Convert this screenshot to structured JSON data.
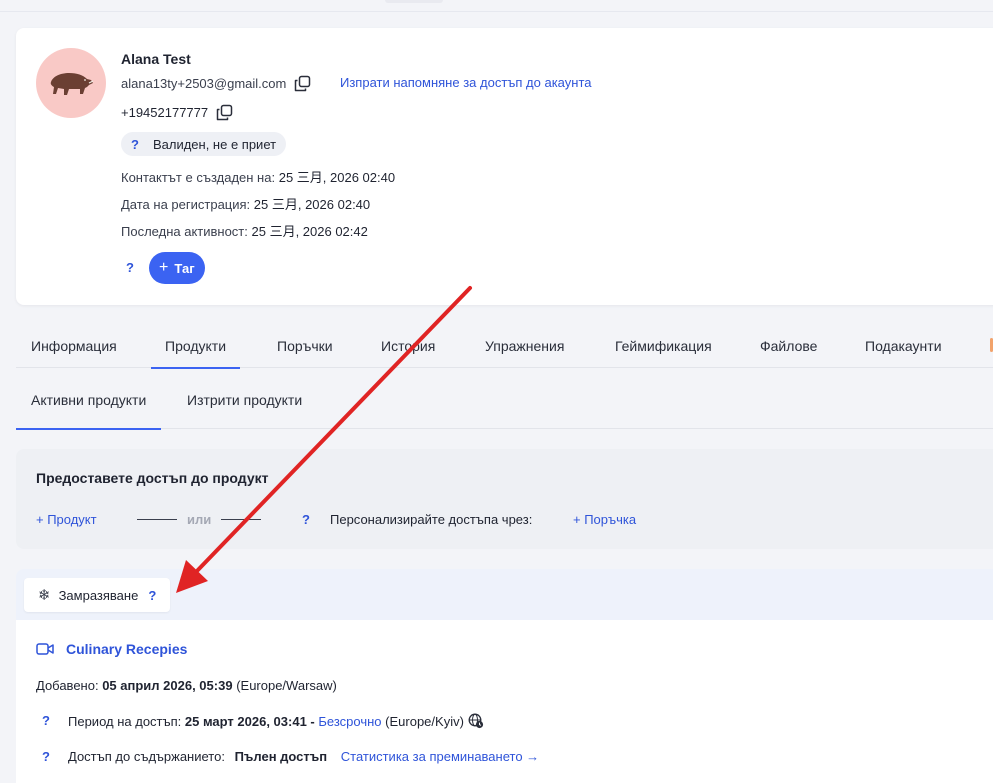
{
  "contact": {
    "name": "Alana Test",
    "email": "alana13ty+2503@gmail.com",
    "reminder_link": "Изпрати напомняне за достъп до акаунта",
    "phone": "+19452177777",
    "status_q": "?",
    "status": "Валиден, не е приет",
    "created_label": "Контактът е създаден на:",
    "created_value": "25 三月, 2026 02:40",
    "registered_label": "Дата на регистрация:",
    "registered_value": "25 三月, 2026 02:40",
    "last_active_label": "Последна активност:",
    "last_active_value": "25 三月, 2026 02:42",
    "tag_q": "?",
    "tag_plus": "+",
    "tag_button": "Таг"
  },
  "tabs": [
    "Информация",
    "Продукти",
    "Поръчки",
    "История",
    "Упражнения",
    "Геймификация",
    "Файлове",
    "Подакаунти"
  ],
  "active_tab": "Продукти",
  "subtabs": [
    "Активни продукти",
    "Изтрити продукти"
  ],
  "grant": {
    "title": "Предоставете достъп до продукт",
    "product_link": "+ Продукт",
    "or": "или",
    "q": "?",
    "customize": "Персонализирайте достъпа чрез:",
    "order_link": "+ Поръчка"
  },
  "freeze": {
    "label": "Замразяване",
    "q": "?"
  },
  "product": {
    "name": "Culinary Recepies",
    "added_label": "Добавено:",
    "added_value": "05 април 2026, 05:39",
    "added_tz": "(Europe/Warsaw)",
    "period_q": "?",
    "period_label": "Период на достъп:",
    "period_start": "25 март 2026, 03:41 -",
    "period_end": "Безсрочно",
    "period_tz": "(Europe/Kyiv)",
    "access_q": "?",
    "access_label": "Достъп до съдържанието:",
    "access_value": "Пълен достъп",
    "stats_link": "Статистика за преминаването →"
  },
  "colors": {
    "accent": "#3b63f2",
    "link": "#2f54d9",
    "avatar_bg": "#f9c9c6",
    "arrow": "#e02424"
  }
}
